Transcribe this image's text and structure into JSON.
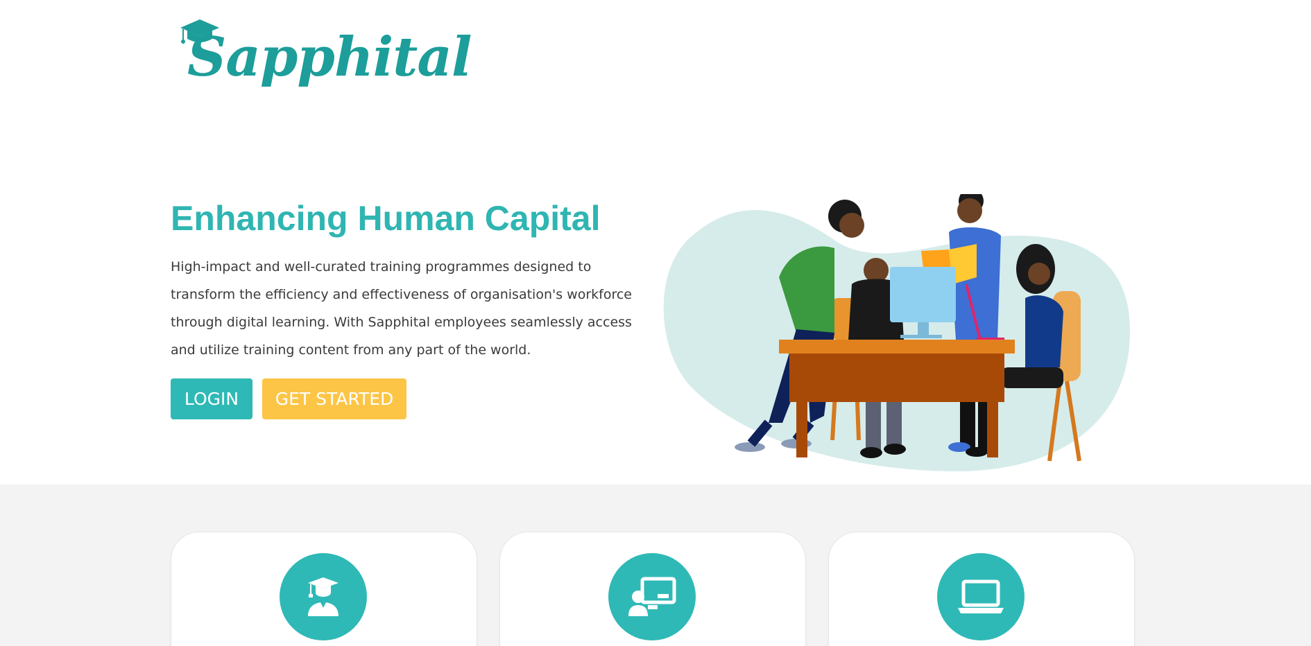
{
  "brand": {
    "name": "Sapphital",
    "color": "#1d9e9a"
  },
  "hero": {
    "title": "Enhancing Human Capital",
    "description": "High-impact and well-curated training programmes designed to transform the efficiency and effectiveness of organisation's workforce through digital learning. With Sapphital employees seamlessly access and utilize training content from any part of the world.",
    "login_label": "LOGIN",
    "get_started_label": "GET STARTED",
    "accent_color": "#2fb5b2",
    "cta_color": "#fcc545"
  },
  "features": {
    "cards": [
      {
        "icon": "graduate-icon"
      },
      {
        "icon": "teacher-board-icon"
      },
      {
        "icon": "laptop-icon"
      }
    ]
  }
}
